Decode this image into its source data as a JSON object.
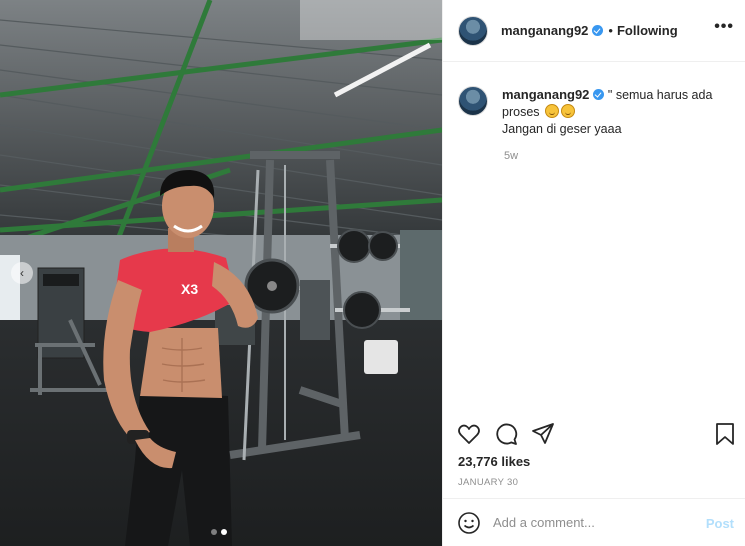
{
  "post": {
    "username": "manganang92",
    "separator": "•",
    "follow_state": "Following",
    "more_glyph": "•••",
    "caption_line1": "\" semua harus ada proses",
    "caption_line2": "Jangan di geser yaaa",
    "caption_emoji": "blush-emoji",
    "age": "5w",
    "likes": "23,776 likes",
    "date": "JANUARY 30",
    "comment_placeholder": "Add a comment...",
    "post_label": "Post"
  },
  "carousel": {
    "prev_glyph": "‹",
    "slide_count": 2,
    "active_slide": 2
  },
  "icons": [
    "heart-icon",
    "comment-icon",
    "share-icon",
    "bookmark-icon",
    "emoji-icon",
    "verified-icon"
  ],
  "colors": {
    "verified": "#3897f0",
    "post_button": "#b2dffc",
    "muted_text": "#8e8e8e",
    "text": "#262626"
  }
}
